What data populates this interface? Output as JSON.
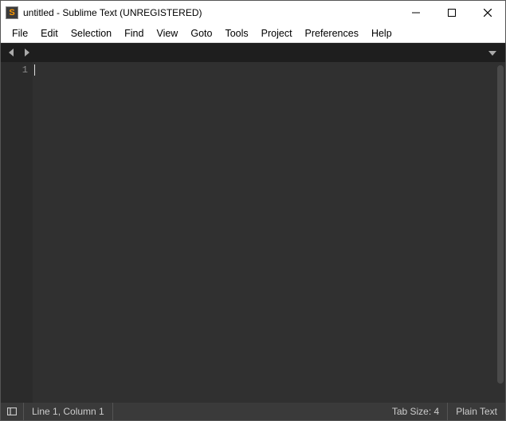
{
  "window": {
    "title": "untitled - Sublime Text (UNREGISTERED)"
  },
  "menu": {
    "items": [
      "File",
      "Edit",
      "Selection",
      "Find",
      "View",
      "Goto",
      "Tools",
      "Project",
      "Preferences",
      "Help"
    ]
  },
  "editor": {
    "line_numbers": [
      "1"
    ],
    "content": "",
    "cursor_visible": true
  },
  "status": {
    "position": "Line 1, Column 1",
    "tab_size": "Tab Size: 4",
    "syntax": "Plain Text"
  },
  "app_icon_letter": "S"
}
